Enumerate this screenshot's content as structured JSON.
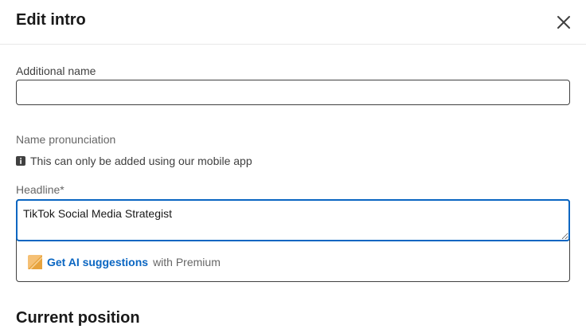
{
  "dialog": {
    "title": "Edit intro",
    "close_icon": "close-icon"
  },
  "form": {
    "additional_name": {
      "label": "Additional name",
      "value": ""
    },
    "name_pronunciation": {
      "label": "Name pronunciation",
      "info_icon": "info-icon",
      "info_text": "This can only be added using our mobile app"
    },
    "headline": {
      "label": "Headline*",
      "value": "TikTok Social Media Strategist",
      "ai_icon": "premium-ai-icon",
      "ai_link": "Get AI suggestions",
      "ai_suffix": "with Premium"
    },
    "current_position": {
      "title": "Current position"
    }
  },
  "colors": {
    "accent": "#0a66c2",
    "premium": "#e7a33e"
  }
}
